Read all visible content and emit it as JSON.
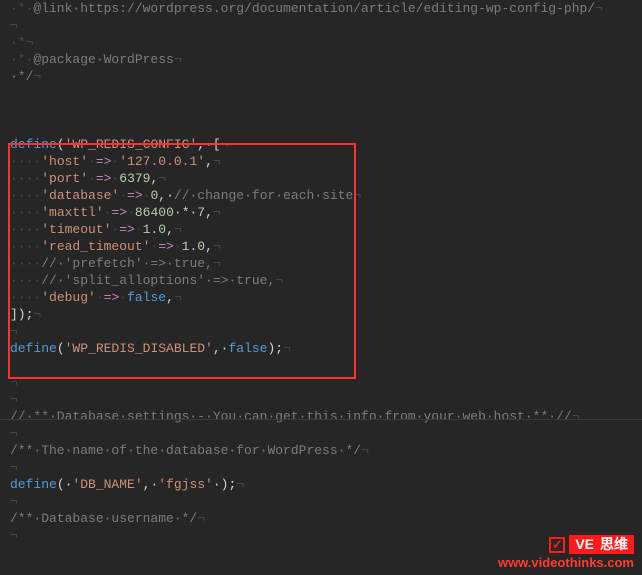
{
  "watermark": {
    "check": "✓",
    "brand_prefix": "VE",
    "brand_suffix": "思维",
    "url": "www.videothinks.com"
  },
  "lines": [
    [
      {
        "t": "·*·",
        "c": "ws"
      },
      {
        "t": "@link·https://wordpress.org/documentation/article/editing-wp-config-php/",
        "c": "comment"
      },
      {
        "t": "¬",
        "c": "ws"
      }
    ],
    [
      {
        "t": "¬",
        "c": "ws"
      }
    ],
    [
      {
        "t": "·*",
        "c": "ws"
      },
      {
        "t": "¬",
        "c": "ws"
      }
    ],
    [
      {
        "t": "·*·",
        "c": "ws"
      },
      {
        "t": "@package·WordPress",
        "c": "comment"
      },
      {
        "t": "¬",
        "c": "ws"
      }
    ],
    [
      {
        "t": "·*/",
        "c": "comment"
      },
      {
        "t": "¬",
        "c": "ws"
      }
    ],
    [
      {
        "t": "",
        "c": "ws"
      }
    ],
    [
      {
        "t": "",
        "c": "ws"
      }
    ],
    [
      {
        "t": "",
        "c": "ws"
      }
    ],
    [
      {
        "t": "define",
        "c": "kw"
      },
      {
        "t": "(",
        "c": "punc"
      },
      {
        "t": "'WP_REDIS_CONFIG'",
        "c": "str"
      },
      {
        "t": ",·[",
        "c": "punc"
      },
      {
        "t": "¬",
        "c": "ws"
      }
    ],
    [
      {
        "t": "····",
        "c": "ws"
      },
      {
        "t": "'host'",
        "c": "str"
      },
      {
        "t": "·",
        "c": "ws"
      },
      {
        "t": "=>",
        "c": "pink"
      },
      {
        "t": "·",
        "c": "ws"
      },
      {
        "t": "'127.0.0.1'",
        "c": "str"
      },
      {
        "t": ",",
        "c": "punc"
      },
      {
        "t": "¬",
        "c": "ws"
      }
    ],
    [
      {
        "t": "····",
        "c": "ws"
      },
      {
        "t": "'port'",
        "c": "str"
      },
      {
        "t": "·",
        "c": "ws"
      },
      {
        "t": "=>",
        "c": "pink"
      },
      {
        "t": "·",
        "c": "ws"
      },
      {
        "t": "6379",
        "c": "num"
      },
      {
        "t": ",",
        "c": "punc"
      },
      {
        "t": "¬",
        "c": "ws"
      }
    ],
    [
      {
        "t": "····",
        "c": "ws"
      },
      {
        "t": "'database'",
        "c": "str"
      },
      {
        "t": "·",
        "c": "ws"
      },
      {
        "t": "=>",
        "c": "pink"
      },
      {
        "t": "·",
        "c": "ws"
      },
      {
        "t": "0",
        "c": "num"
      },
      {
        "t": ",·",
        "c": "punc"
      },
      {
        "t": "//·change·for·each·site",
        "c": "comment"
      },
      {
        "t": "¬",
        "c": "ws"
      }
    ],
    [
      {
        "t": "····",
        "c": "ws"
      },
      {
        "t": "'maxttl'",
        "c": "str"
      },
      {
        "t": "·",
        "c": "ws"
      },
      {
        "t": "=>",
        "c": "pink"
      },
      {
        "t": "·",
        "c": "ws"
      },
      {
        "t": "86400",
        "c": "num"
      },
      {
        "t": "·*·",
        "c": "op"
      },
      {
        "t": "7",
        "c": "num"
      },
      {
        "t": ",",
        "c": "punc"
      },
      {
        "t": "¬",
        "c": "ws"
      }
    ],
    [
      {
        "t": "····",
        "c": "ws"
      },
      {
        "t": "'timeout'",
        "c": "str"
      },
      {
        "t": "·",
        "c": "ws"
      },
      {
        "t": "=>",
        "c": "pink"
      },
      {
        "t": "·",
        "c": "ws"
      },
      {
        "t": "1.0",
        "c": "num"
      },
      {
        "t": ",",
        "c": "punc"
      },
      {
        "t": "¬",
        "c": "ws"
      }
    ],
    [
      {
        "t": "····",
        "c": "ws"
      },
      {
        "t": "'read_timeout'",
        "c": "str"
      },
      {
        "t": "·",
        "c": "ws"
      },
      {
        "t": "=>",
        "c": "pink"
      },
      {
        "t": "·",
        "c": "ws"
      },
      {
        "t": "1.0",
        "c": "num"
      },
      {
        "t": ",",
        "c": "punc"
      },
      {
        "t": "¬",
        "c": "ws"
      }
    ],
    [
      {
        "t": "····",
        "c": "ws"
      },
      {
        "t": "//·'prefetch'·=>·true,",
        "c": "comment"
      },
      {
        "t": "¬",
        "c": "ws"
      }
    ],
    [
      {
        "t": "····",
        "c": "ws"
      },
      {
        "t": "//·'split_alloptions'·=>·true,",
        "c": "comment"
      },
      {
        "t": "¬",
        "c": "ws"
      }
    ],
    [
      {
        "t": "····",
        "c": "ws"
      },
      {
        "t": "'debug'",
        "c": "str"
      },
      {
        "t": "·",
        "c": "ws"
      },
      {
        "t": "=>",
        "c": "pink"
      },
      {
        "t": "·",
        "c": "ws"
      },
      {
        "t": "false",
        "c": "bool"
      },
      {
        "t": ",",
        "c": "punc"
      },
      {
        "t": "¬",
        "c": "ws"
      }
    ],
    [
      {
        "t": "]);",
        "c": "punc"
      },
      {
        "t": "¬",
        "c": "ws"
      }
    ],
    [
      {
        "t": "¬",
        "c": "ws"
      }
    ],
    [
      {
        "t": "define",
        "c": "kw"
      },
      {
        "t": "(",
        "c": "punc"
      },
      {
        "t": "'WP_REDIS_DISABLED'",
        "c": "str"
      },
      {
        "t": ",·",
        "c": "punc"
      },
      {
        "t": "false",
        "c": "bool"
      },
      {
        "t": ");",
        "c": "punc"
      },
      {
        "t": "¬",
        "c": "ws"
      }
    ],
    [
      {
        "t": "",
        "c": "ws"
      }
    ],
    [
      {
        "t": "¬",
        "c": "ws"
      }
    ],
    [
      {
        "t": "¬",
        "c": "ws"
      }
    ],
    [
      {
        "t": "//·**·Database·settings·-·You·can·get·this·info·from·your·web·host·**·//",
        "c": "comment"
      },
      {
        "t": "¬",
        "c": "ws"
      }
    ],
    [
      {
        "t": "¬",
        "c": "ws"
      }
    ],
    [
      {
        "t": "/**·The·name·of·the·database·for·WordPress·*/",
        "c": "comment"
      },
      {
        "t": "¬",
        "c": "ws"
      }
    ],
    [
      {
        "t": "¬",
        "c": "ws"
      }
    ],
    [
      {
        "t": "define",
        "c": "kw"
      },
      {
        "t": "(·",
        "c": "punc"
      },
      {
        "t": "'DB_NAME'",
        "c": "str"
      },
      {
        "t": ",·",
        "c": "punc"
      },
      {
        "t": "'fgjss'",
        "c": "str"
      },
      {
        "t": "·);",
        "c": "punc"
      },
      {
        "t": "¬",
        "c": "ws"
      }
    ],
    [
      {
        "t": "¬",
        "c": "ws"
      }
    ],
    [
      {
        "t": "/**·Database·username·*/",
        "c": "comment"
      },
      {
        "t": "¬",
        "c": "ws"
      }
    ],
    [
      {
        "t": "¬",
        "c": "ws"
      }
    ]
  ]
}
